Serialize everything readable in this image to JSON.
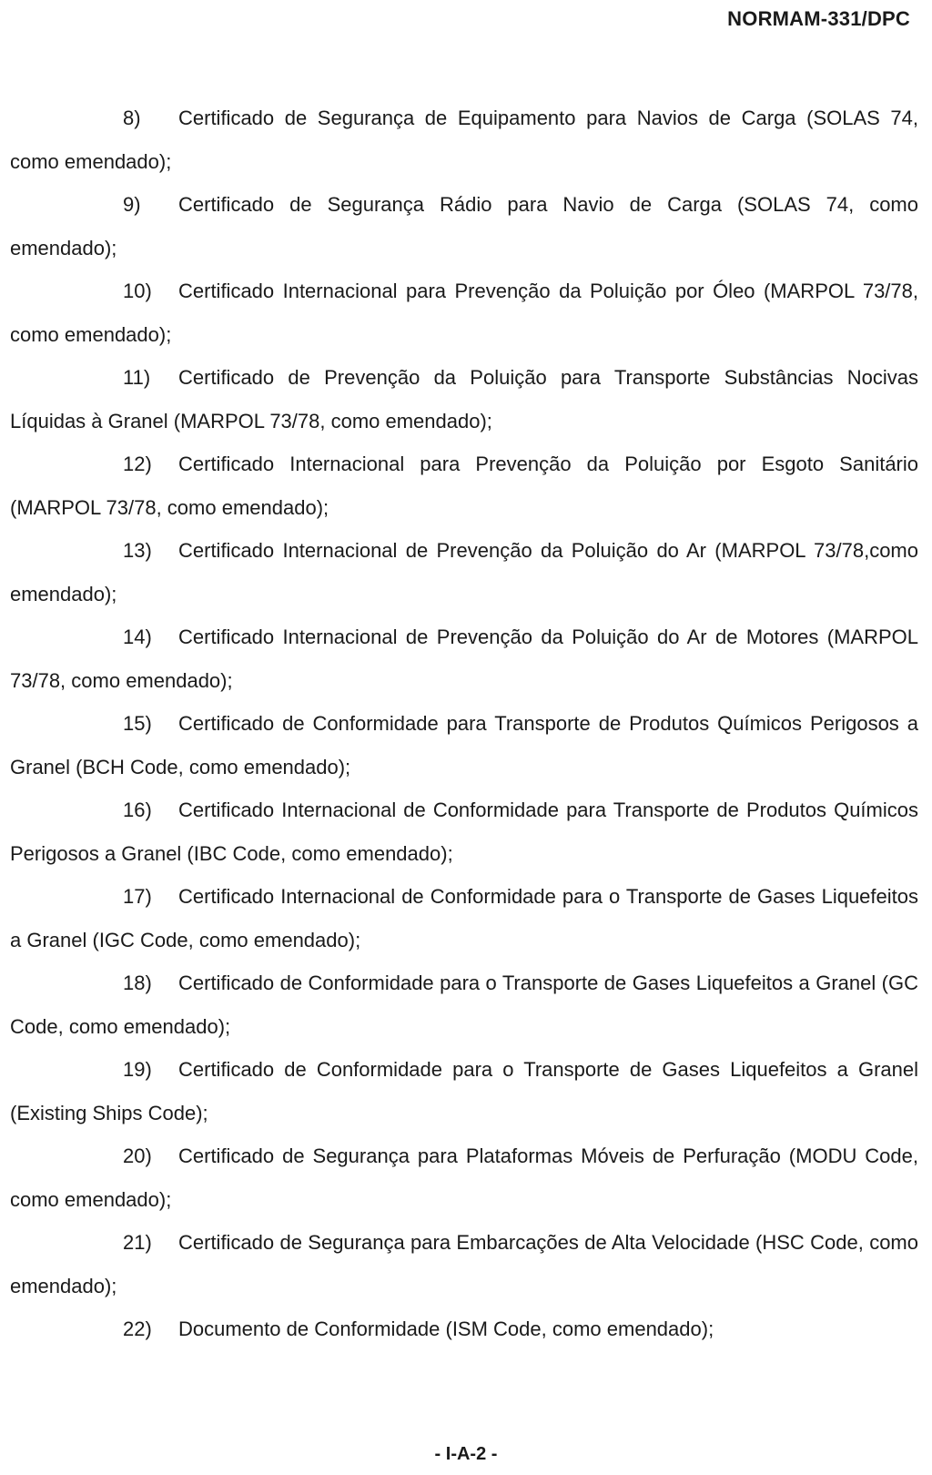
{
  "header": {
    "doc_code": "NORMAM-331/DPC"
  },
  "items": [
    {
      "num": "8)",
      "text": "Certificado de Segurança de Equipamento para Navios de Carga (SOLAS 74, como emendado);"
    },
    {
      "num": "9)",
      "text": "Certificado de Segurança Rádio para Navio de Carga (SOLAS 74, como emendado);"
    },
    {
      "num": "10)",
      "text": "Certificado Internacional para Prevenção da Poluição por Óleo (MARPOL 73/78, como emendado);"
    },
    {
      "num": "11)",
      "text": "Certificado de Prevenção da Poluição para Transporte Substâncias Nocivas Líquidas à Granel (MARPOL 73/78, como emendado);"
    },
    {
      "num": "12)",
      "text": "Certificado Internacional para Prevenção da Poluição por Esgoto Sanitário (MARPOL 73/78, como emendado);"
    },
    {
      "num": "13)",
      "text": "Certificado Internacional de Prevenção da Poluição do Ar (MARPOL 73/78,como emendado);"
    },
    {
      "num": "14)",
      "text": "Certificado Internacional de Prevenção da Poluição do Ar de Motores (MARPOL 73/78, como emendado);"
    },
    {
      "num": "15)",
      "text": "Certificado de Conformidade para Transporte de Produtos Químicos Perigosos a Granel (BCH Code, como emendado);"
    },
    {
      "num": "16)",
      "text": "Certificado Internacional de Conformidade para Transporte de Produtos Químicos Perigosos a Granel (IBC Code, como emendado);"
    },
    {
      "num": "17)",
      "text": "Certificado Internacional de Conformidade para o Transporte de Gases Liquefeitos a Granel (IGC Code, como emendado);"
    },
    {
      "num": "18)",
      "text": "Certificado de Conformidade para o Transporte de Gases Liquefeitos a Granel (GC Code, como emendado);"
    },
    {
      "num": "19)",
      "text": "Certificado de Conformidade para o Transporte de Gases Liquefeitos a Granel (Existing Ships Code);"
    },
    {
      "num": "20)",
      "text": "Certificado de Segurança para Plataformas Móveis de Perfuração (MODU Code, como emendado);"
    },
    {
      "num": "21)",
      "text": "Certificado de Segurança para Embarcações de Alta Velocidade (HSC Code, como emendado);"
    },
    {
      "num": "22)",
      "text": "Documento de Conformidade (ISM Code, como emendado);"
    }
  ],
  "footer": {
    "page_number": "- I-A-2 -"
  }
}
